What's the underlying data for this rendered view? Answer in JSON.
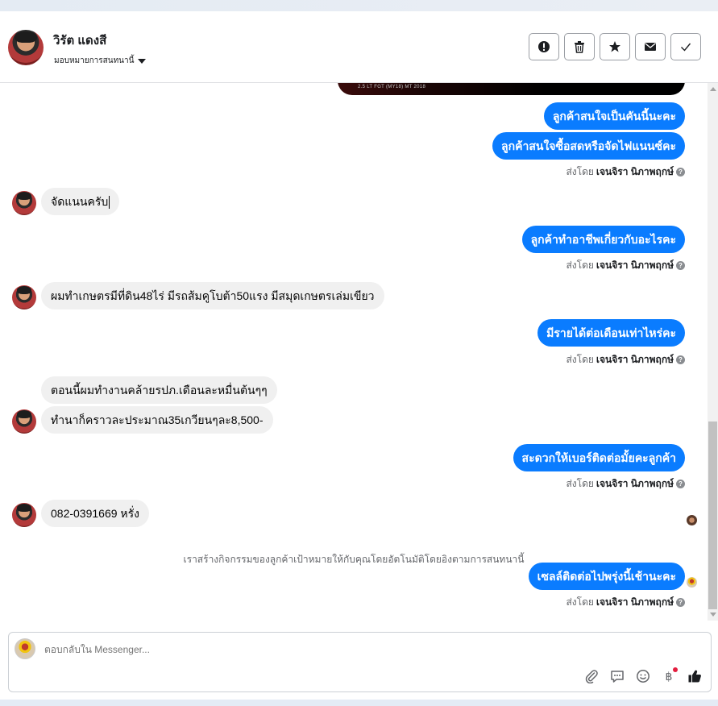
{
  "header": {
    "contact_name": "วิรัต แดงสี",
    "assign_label": "มอบหมายการสนทนานี้",
    "buttons": [
      {
        "name": "report-spam-button",
        "icon": "exclamation-icon"
      },
      {
        "name": "delete-button",
        "icon": "trash-icon"
      },
      {
        "name": "star-button",
        "icon": "star-icon"
      },
      {
        "name": "mark-unread-button",
        "icon": "envelope-icon"
      },
      {
        "name": "mark-done-button",
        "icon": "check-icon"
      }
    ]
  },
  "conversation": {
    "image_caption": "2.5 LT FGT (MY18) MT 2018",
    "messages": [
      {
        "direction": "out",
        "text": "ลูกค้าสนใจเป็นคันนี้นะคะ"
      },
      {
        "direction": "out",
        "text": "ลูกค้าสนใจซื้อสดหรือจัดไฟแนนซ์คะ"
      },
      {
        "direction": "in",
        "text": "จัดแนนครับ"
      },
      {
        "direction": "out",
        "text": "ลูกค้าทำอาชีพเกี่ยวกับอะไรคะ"
      },
      {
        "direction": "in",
        "text": "ผมทำเกษตรมีที่ดิน48ไร่ มีรถส้มคูโบต้า50แรง มีสมุดเกษตรเล่มเขียว"
      },
      {
        "direction": "out",
        "text": "มีรายได้ต่อเดือนเท่าไหร่คะ"
      },
      {
        "direction": "in",
        "text": "ตอนนี้ผมทำงานคล้ายรปภ.เดือนละหมื่นต้นๆๆ"
      },
      {
        "direction": "in",
        "text": "ทำนาก็คราวละประมาณ35เกวียนๆละ8,500-"
      },
      {
        "direction": "out",
        "text": "สะดวกให้เบอร์ติดต่อมั้ยคะลูกค้า"
      },
      {
        "direction": "in",
        "text": "082-0391669 หรั่ง"
      },
      {
        "direction": "out",
        "text": "เซลล์ติดต่อไปพรุ่งนี้เช้านะคะ"
      }
    ],
    "sent_by_prefix": "ส่งโดย",
    "sent_by_name": "เจนจิรา นิภาพฤกษ์",
    "system_note": "เราสร้างกิจกรรมของลูกค้าเป้าหมายให้กับคุณโดยอัตโนมัติโดยอิงตามการสนทนานี้"
  },
  "composer": {
    "placeholder": "ตอบกลับใน Messenger...",
    "tools": [
      "paperclip-icon",
      "saved-reply-icon",
      "emoji-icon",
      "baht-payment-icon",
      "like-icon"
    ]
  },
  "colors": {
    "outgoing_bubble": "#0a7cff",
    "incoming_bubble": "#f0f0f0",
    "notification_dot": "#e41e3f"
  }
}
